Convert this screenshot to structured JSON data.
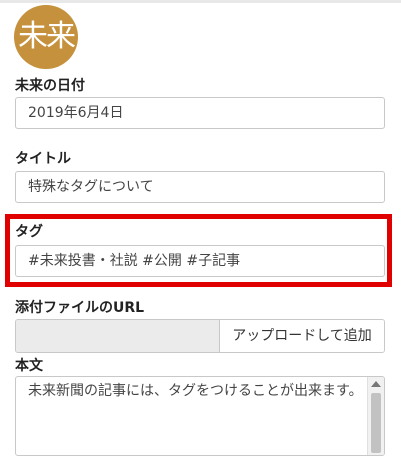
{
  "logo": {
    "text": "未来",
    "color": "#c6913c"
  },
  "form": {
    "date": {
      "label": "未来の日付",
      "value": "2019年6月4日"
    },
    "title": {
      "label": "タイトル",
      "value": "特殊なタグについて"
    },
    "tags": {
      "label": "タグ",
      "value": "#未来投書・社説 #公開 #子記事",
      "highlight_color": "#e00000"
    },
    "attachment": {
      "label": "添付ファイルのURL",
      "value": "",
      "upload_label": "アップロードして追加"
    },
    "body": {
      "label": "本文",
      "value": "未来新聞の記事には、タグをつけることが出来ます。"
    }
  }
}
